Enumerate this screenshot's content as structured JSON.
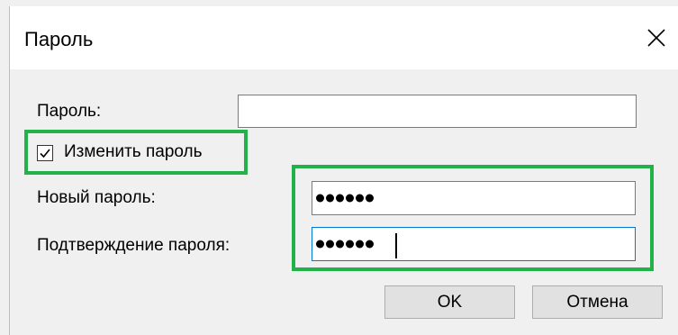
{
  "dialog": {
    "title": "Пароль",
    "close_icon": "close-icon"
  },
  "form": {
    "password_label": "Пароль:",
    "password_value": "",
    "change_password_label": "Изменить пароль",
    "change_password_checked": true,
    "new_password_label": "Новый пароль:",
    "new_password_masked_length": 6,
    "confirm_password_label": "Подтверждение пароля:",
    "confirm_password_masked_length": 6
  },
  "buttons": {
    "ok_label": "OK",
    "cancel_label": "Отмена"
  },
  "colors": {
    "highlight": "#21b24a",
    "focus_border": "#0078d7",
    "dialog_bg": "#f0f0f0"
  }
}
